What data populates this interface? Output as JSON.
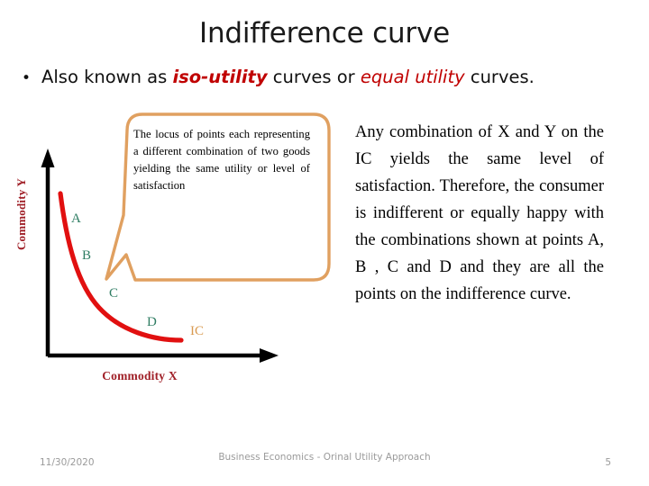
{
  "slide": {
    "title": "Indifference curve",
    "page_number": "5"
  },
  "bullet": {
    "marker": "•",
    "part1": "Also known as ",
    "emphasis1": "iso-utility",
    "part2": " curves or ",
    "emphasis2": "equal utility",
    "part3": " curves."
  },
  "graph": {
    "y_axis_label": "Commodity Y",
    "x_axis_label": "Commodity X",
    "curve_label": "IC",
    "points": [
      {
        "label": "A"
      },
      {
        "label": "B"
      },
      {
        "label": "C"
      },
      {
        "label": "D"
      }
    ]
  },
  "callout": {
    "text": "The locus of points each representing a different combination of two goods yielding the same utility or level of satisfaction"
  },
  "body_right": {
    "text": "Any combination of X and Y on the IC yields the same level of satisfaction. Therefore, the consumer is indifferent or equally happy with the combinations shown at points A, B , C and D and they are all the points on the indifference curve."
  },
  "footer": {
    "date": "11/30/2020",
    "center_text": "Business Economics - Orinal Utility Approach",
    "page": "5"
  },
  "colors": {
    "accent_red": "#c00000",
    "curve_red": "#e11010",
    "axis_label": "#a02028",
    "point_label": "#2f7d63",
    "callout_border": "#e0a060",
    "footer_gray": "#9a9a9a"
  }
}
